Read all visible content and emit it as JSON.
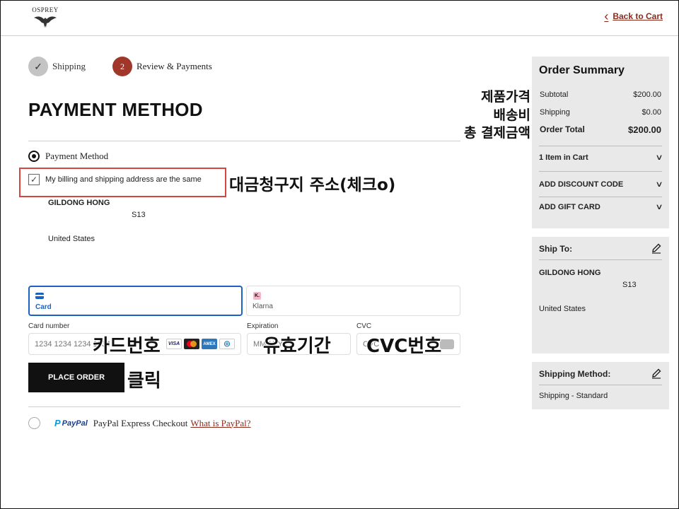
{
  "header": {
    "logo_text": "OSPREY",
    "back_label": "Back to Cart"
  },
  "steps": [
    {
      "label": "Shipping",
      "state": "done",
      "marker": "✓"
    },
    {
      "label": "Review & Payments",
      "state": "active",
      "marker": "2"
    }
  ],
  "page_title": "PAYMENT METHOD",
  "payment": {
    "method_label": "Payment Method",
    "billing_same_label": "My billing and shipping address are the same",
    "billing_checked": true,
    "address": {
      "name": "GILDONG HONG",
      "line": "S13",
      "country": "United States"
    },
    "tabs": [
      {
        "label": "Card",
        "icon": "card-icon",
        "selected": true
      },
      {
        "label": "Klarna",
        "icon": "klarna-icon",
        "selected": false
      }
    ],
    "klarna_badge": "K.",
    "card_number": {
      "label": "Card number",
      "placeholder": "1234 1234 1234 1234"
    },
    "expiration": {
      "label": "Expiration",
      "placeholder": "MM / YY"
    },
    "cvc": {
      "label": "CVC",
      "placeholder": "CVC"
    },
    "card_brands": [
      "VISA",
      "mastercard",
      "AMEX",
      "diners"
    ],
    "place_order_label": "PLACE ORDER",
    "paypal": {
      "logo_text": "PayPal",
      "label": "PayPal Express Checkout",
      "link": "What is PayPal?"
    }
  },
  "annotations": {
    "product_price": "제품가격",
    "shipping_fee": "배송비",
    "total_amount": "총 결제금액",
    "billing_address": "대금청구지 주소(체크o)",
    "card_number": "카드번호",
    "expiration": "유효기간",
    "cvc": "CVC번호",
    "click": "클릭"
  },
  "summary": {
    "title": "Order Summary",
    "subtotal_label": "Subtotal",
    "subtotal_value": "$200.00",
    "shipping_label": "Shipping",
    "shipping_value": "$0.00",
    "total_label": "Order Total",
    "total_value": "$200.00",
    "items_label": "1 Item in Cart",
    "discount_label": "ADD DISCOUNT CODE",
    "gift_label": "ADD GIFT CARD"
  },
  "ship_to": {
    "title": "Ship To:",
    "name": "GILDONG HONG",
    "line": "S13",
    "country": "United States"
  },
  "ship_method": {
    "title": "Shipping Method:",
    "value": "Shipping - Standard"
  },
  "colors": {
    "accent": "#a0372a",
    "link": "#8a2a1d",
    "card_tab": "#1c63c1",
    "highlight_box": "#d6453f",
    "panel_bg": "#e9e9e9"
  }
}
